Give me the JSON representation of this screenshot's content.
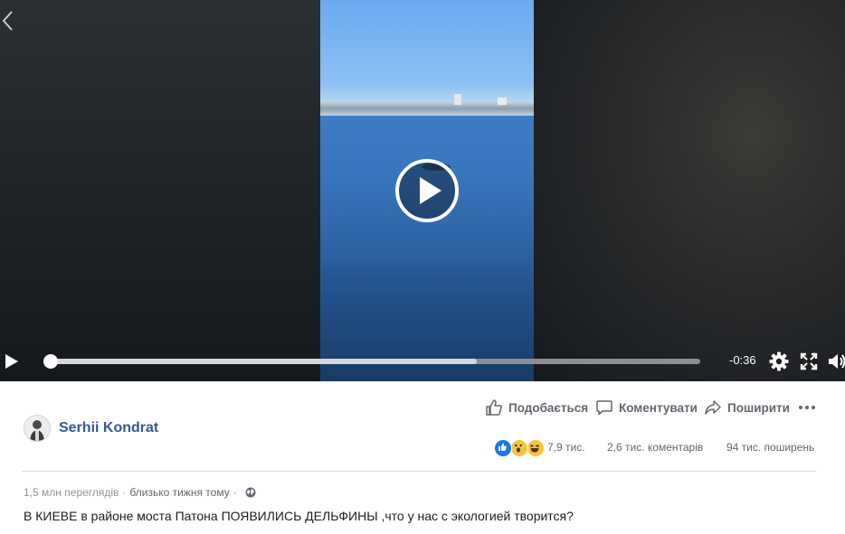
{
  "video": {
    "time_remaining": "-0:36",
    "progress_fraction": 0,
    "buffered_fraction": 0.658
  },
  "post": {
    "author": "Serhii Kondrat",
    "actions": {
      "like": "Подобається",
      "comment": "Коментувати",
      "share": "Поширити"
    },
    "stats": {
      "reactions_count": "7,9 тис.",
      "comments": "2,6 тис. коментарів",
      "shares": "94 тис. поширень"
    },
    "views": "1,5 млн переглядів",
    "separator": "·",
    "date": "близько тижня тому",
    "caption": "В КИЕВЕ в районе моста Патона ПОЯВИЛИСЬ ДЕЛЬФИНЫ ,что у нас с экологией творится?"
  },
  "colors": {
    "link": "#365899",
    "secondary_text": "#606770",
    "meta_text": "#90949c",
    "like_blue": "#1877f2",
    "reaction_yellow": "#f7c53a"
  },
  "icons": [
    "back-chevron-icon",
    "play-circle-icon",
    "play-icon",
    "gear-icon",
    "fullscreen-icon",
    "volume-icon",
    "like-icon",
    "comment-icon",
    "share-icon",
    "more-icon",
    "like-reaction-icon",
    "wow-reaction-icon",
    "haha-reaction-icon",
    "globe-icon"
  ]
}
